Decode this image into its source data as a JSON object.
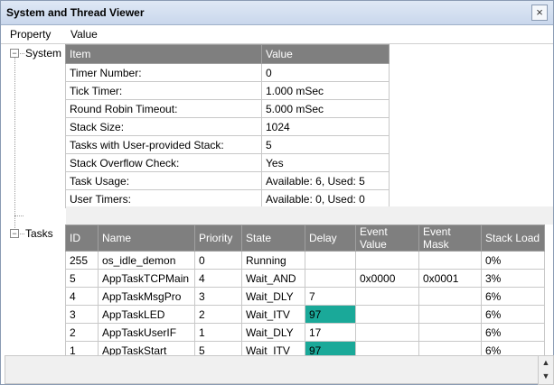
{
  "window": {
    "title": "System and Thread Viewer",
    "close_glyph": "×"
  },
  "columns": {
    "property": "Property",
    "value": "Value"
  },
  "tree": {
    "system_label": "System",
    "tasks_label": "Tasks",
    "collapse_glyph": "−"
  },
  "system": {
    "headers": [
      "Item",
      "Value"
    ],
    "rows": [
      [
        "Timer Number:",
        "0"
      ],
      [
        "Tick Timer:",
        "1.000 mSec"
      ],
      [
        "Round Robin Timeout:",
        "5.000 mSec"
      ],
      [
        "Stack Size:",
        "1024"
      ],
      [
        "Tasks with User-provided Stack:",
        "5"
      ],
      [
        "Stack Overflow Check:",
        "Yes"
      ],
      [
        "Task Usage:",
        "Available: 6, Used: 5"
      ],
      [
        "User Timers:",
        "Available: 0, Used: 0"
      ]
    ]
  },
  "tasks": {
    "headers": [
      "ID",
      "Name",
      "Priority",
      "State",
      "Delay",
      "Event Value",
      "Event Mask",
      "Stack Load"
    ],
    "rows": [
      [
        "255",
        "os_idle_demon",
        "0",
        "Running",
        "",
        "",
        "",
        "0%"
      ],
      [
        "5",
        "AppTaskTCPMain",
        "4",
        "Wait_AND",
        "",
        "0x0000",
        "0x0001",
        "3%"
      ],
      [
        "4",
        "AppTaskMsgPro",
        "3",
        "Wait_DLY",
        "7",
        "",
        "",
        "6%"
      ],
      [
        "3",
        "AppTaskLED",
        "2",
        "Wait_ITV",
        "97",
        "",
        "",
        "6%"
      ],
      [
        "2",
        "AppTaskUserIF",
        "1",
        "Wait_DLY",
        "17",
        "",
        "",
        "6%"
      ],
      [
        "1",
        "AppTaskStart",
        "5",
        "Wait_ITV",
        "97",
        "",
        "",
        "6%"
      ]
    ],
    "highlight_color": "#1aa999"
  },
  "scroll": {
    "up_glyph": "▲",
    "down_glyph": "▼"
  }
}
